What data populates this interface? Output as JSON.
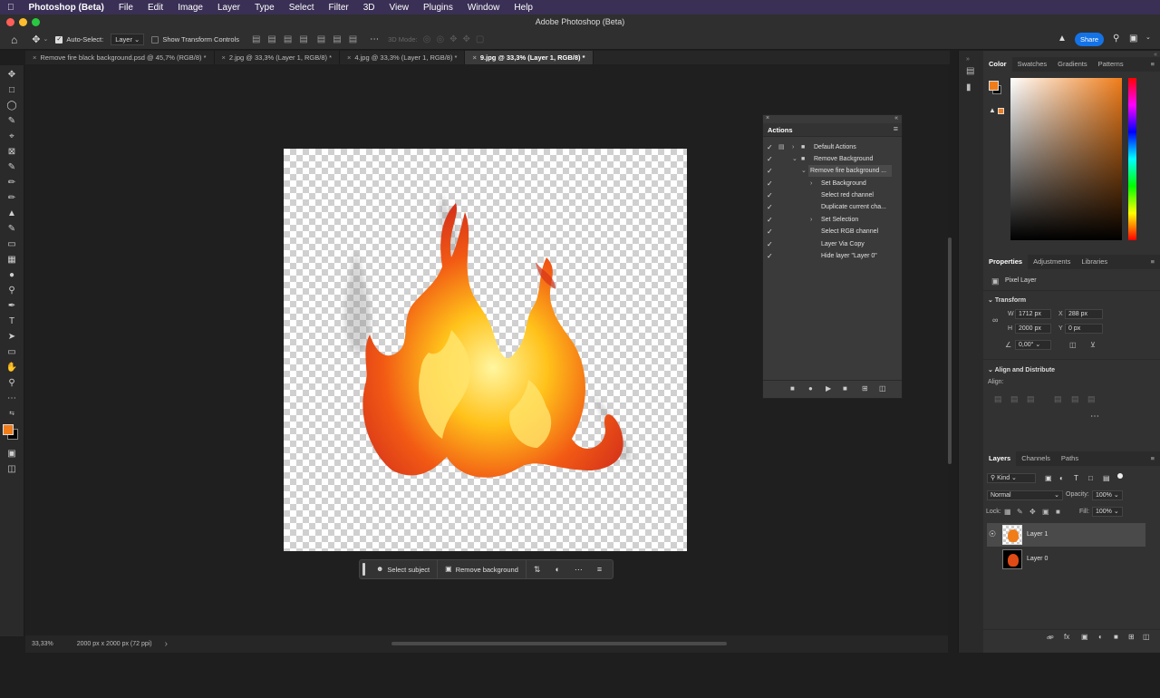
{
  "menubar": {
    "app_name": "Photoshop (Beta)",
    "items": [
      "File",
      "Edit",
      "Image",
      "Layer",
      "Type",
      "Select",
      "Filter",
      "3D",
      "View",
      "Plugins",
      "Window",
      "Help"
    ]
  },
  "window": {
    "title": "Adobe Photoshop (Beta)"
  },
  "options_bar": {
    "auto_select_label": "Auto-Select:",
    "auto_select_value": "Layer",
    "show_transform_label": "Show Transform Controls",
    "mode_3d_label": "3D Mode:",
    "share_label": "Share"
  },
  "tabs": [
    {
      "label": "Remove fire black background.psd @ 45,7% (RGB/8) *",
      "active": false
    },
    {
      "label": "2.jpg @ 33,3% (Layer 1, RGB/8) *",
      "active": false
    },
    {
      "label": "4.jpg @ 33,3% (Layer 1, RGB/8) *",
      "active": false
    },
    {
      "label": "9.jpg @ 33,3% (Layer 1, RGB/8) *",
      "active": true
    }
  ],
  "context_bar": {
    "select_subject": "Select subject",
    "remove_background": "Remove background"
  },
  "status": {
    "zoom": "33,33%",
    "doc_info": "2000 px x 2000 px (72 ppi)"
  },
  "actions_panel": {
    "title": "Actions",
    "rows": [
      {
        "label": "Default Actions",
        "level": 0
      },
      {
        "label": "Remove Background",
        "level": 0
      },
      {
        "label": "Remove fire background ...",
        "level": 1
      },
      {
        "label": "Set Background",
        "level": 2
      },
      {
        "label": "Select red channel",
        "level": 2
      },
      {
        "label": "Duplicate current cha...",
        "level": 2
      },
      {
        "label": "Set Selection",
        "level": 2
      },
      {
        "label": "Select RGB channel",
        "level": 2
      },
      {
        "label": "Layer Via Copy",
        "level": 2
      },
      {
        "label": "Hide layer \"Layer 0\"",
        "level": 2
      }
    ]
  },
  "color_panel": {
    "tabs": [
      "Color",
      "Swatches",
      "Gradients",
      "Patterns"
    ],
    "foreground": "#f07d1a",
    "background": "#000000"
  },
  "properties_panel": {
    "tabs": [
      "Properties",
      "Adjustments",
      "Libraries"
    ],
    "layer_type": "Pixel Layer",
    "transform_title": "Transform",
    "w_label": "W",
    "w_value": "1712 px",
    "x_label": "X",
    "x_value": "288 px",
    "h_label": "H",
    "h_value": "2000 px",
    "y_label": "Y",
    "y_value": "0 px",
    "angle_value": "0,00°",
    "align_title": "Align and Distribute",
    "align_label": "Align:"
  },
  "layers_panel": {
    "tabs": [
      "Layers",
      "Channels",
      "Paths"
    ],
    "filter_kind": "Kind",
    "blend_mode": "Normal",
    "opacity_label": "Opacity:",
    "opacity_value": "100%",
    "lock_label": "Lock:",
    "fill_label": "Fill:",
    "fill_value": "100%",
    "layers": [
      {
        "name": "Layer 1",
        "visible": true,
        "selected": true
      },
      {
        "name": "Layer 0",
        "visible": false,
        "selected": false
      }
    ]
  }
}
